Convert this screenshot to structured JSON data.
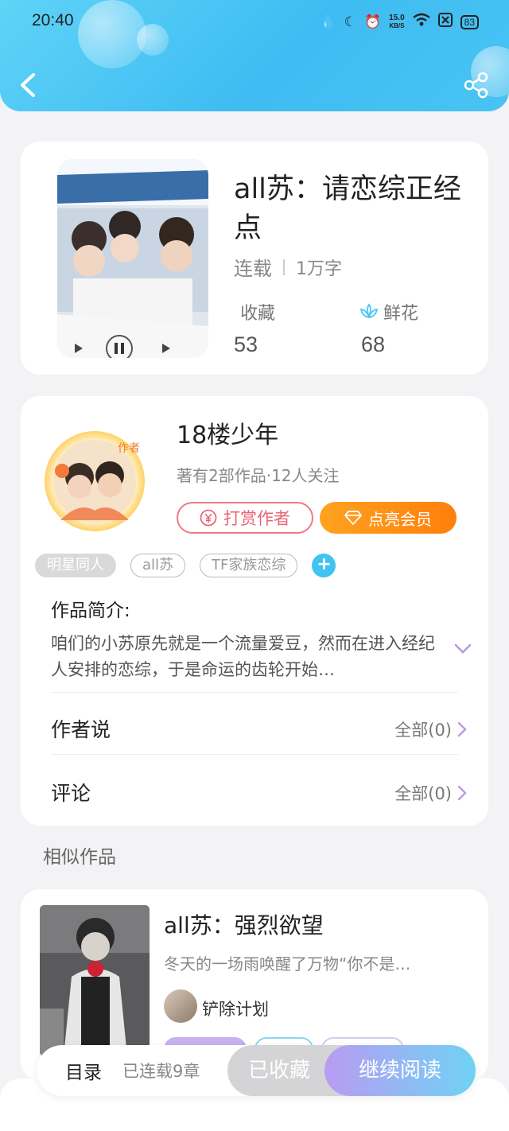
{
  "status_bar": {
    "time": "20:40",
    "net_speed_value": "15.0",
    "net_speed_unit": "KB/S",
    "battery": "83"
  },
  "book": {
    "title": "all苏：请恋综正经点",
    "status": "连载",
    "word_count": "1万字",
    "favorites_label": "收藏",
    "favorites_count": "53",
    "flowers_label": "鲜花",
    "flowers_count": "68"
  },
  "author": {
    "name": "18楼少年",
    "summary": "著有2部作品·12人关注",
    "reward_label": "打赏作者",
    "vip_label": "点亮会员",
    "avatar_badge": "作者"
  },
  "tags": [
    "明星同人",
    "all苏",
    "TF家族恋综"
  ],
  "intro": {
    "label": "作品简介:",
    "text": "咱们的小苏原先就是一个流量爱豆，然而在进入经纪人安排的恋综，于是命运的齿轮开始…"
  },
  "rows": {
    "author_says_label": "作者说",
    "author_says_value": "全部(0)",
    "comments_label": "评论",
    "comments_value": "全部(0)"
  },
  "similar": {
    "section_title": "相似作品",
    "items": [
      {
        "title": "all苏：强烈欲望",
        "desc": "冬天的一场雨唤醒了万物“你不是…",
        "author": "铲除计划"
      }
    ]
  },
  "bottom_bar": {
    "toc_label": "目录",
    "updated_text": "已连载9章",
    "favorited_label": "已收藏",
    "continue_label": "继续阅读"
  },
  "colors": {
    "header": "#3ebcf2",
    "accent_red": "#e96674",
    "accent_orange": "#ff8c14",
    "tag_add": "#40c3f0"
  }
}
